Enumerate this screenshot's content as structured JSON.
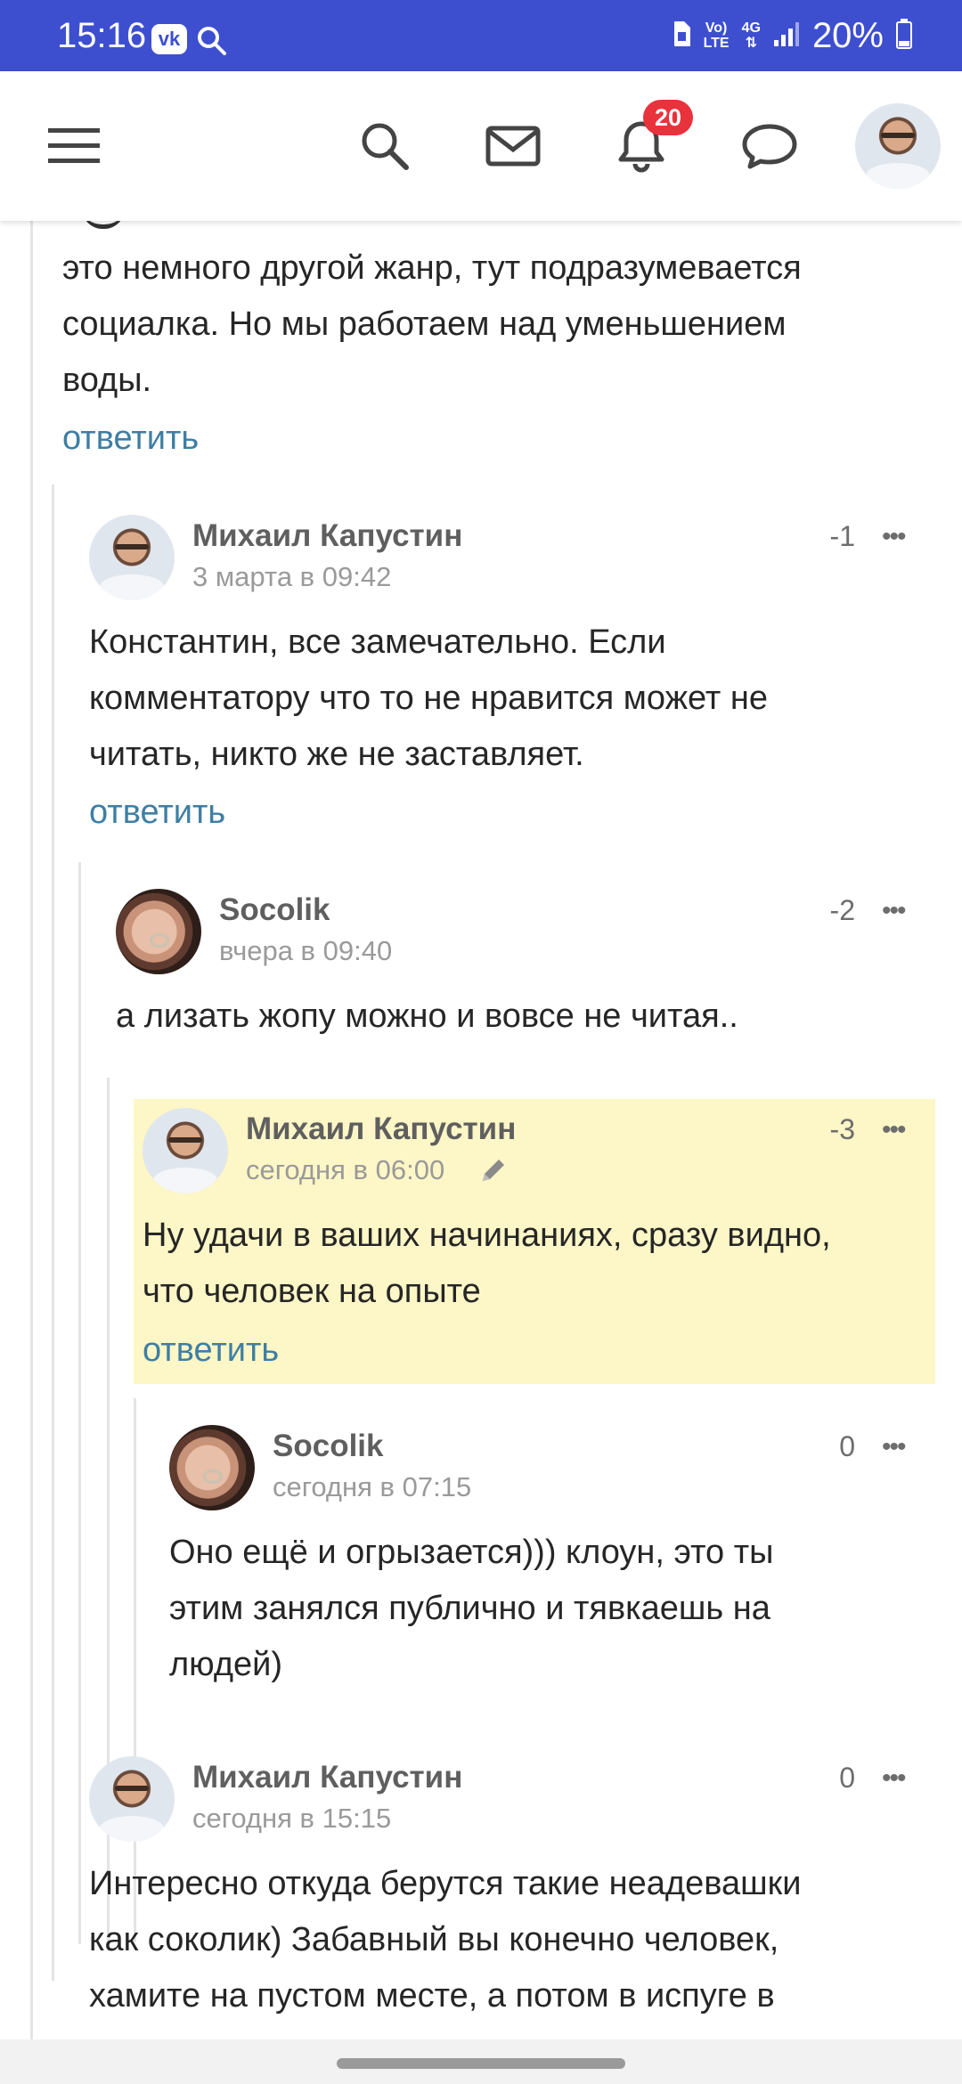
{
  "status_bar": {
    "time": "15:16",
    "vk": "vk",
    "net_top": "Vo)",
    "net_bottom": "LTE",
    "gen": "4G",
    "battery": "20%"
  },
  "header": {
    "notifications_count": "20"
  },
  "comments": [
    {
      "text_lines": [
        "это немного другой жанр, тут подразумевается",
        "социалка. Но мы работаем над уменьшением",
        "воды."
      ],
      "reply": "ответить"
    },
    {
      "author": "Михаил Капустин",
      "date": "3 марта в 09:42",
      "score": "-1",
      "text_lines": [
        "Константин, все замечательно. Если",
        "комментатору что то не нравится может не",
        "читать, никто же не заставляет."
      ],
      "reply": "ответить"
    },
    {
      "author": "Socolik",
      "date": "вчера в 09:40",
      "score": "-2",
      "text_lines": [
        "а лизать жопу можно и вовсе не читая.."
      ]
    },
    {
      "author": "Михаил Капустин",
      "date": "сегодня в 06:00",
      "score": "-3",
      "text_lines": [
        "Ну удачи в ваших начинаниях, сразу видно,",
        "что человек на опыте"
      ],
      "reply": "ответить"
    },
    {
      "author": "Socolik",
      "date": "сегодня в 07:15",
      "score": "0",
      "text_lines": [
        "Оно ещё и огрызается))) клоун, это ты",
        "этим занялся публично и тявкаешь на",
        "людей)"
      ]
    },
    {
      "author": "Михаил Капустин",
      "date": "сегодня в 15:15",
      "score": "0",
      "text_lines": [
        "Интересно откуда берутся такие неадевашки",
        "как соколик) Забавный вы конечно человек,",
        "хамите на пустом месте, а потом в испуге в"
      ]
    }
  ],
  "more_glyph": "•••",
  "colors": {
    "status_bar": "#3d4fcf",
    "link": "#3e7ea3",
    "badge": "#e8323c",
    "highlight": "#fdf6c6"
  }
}
